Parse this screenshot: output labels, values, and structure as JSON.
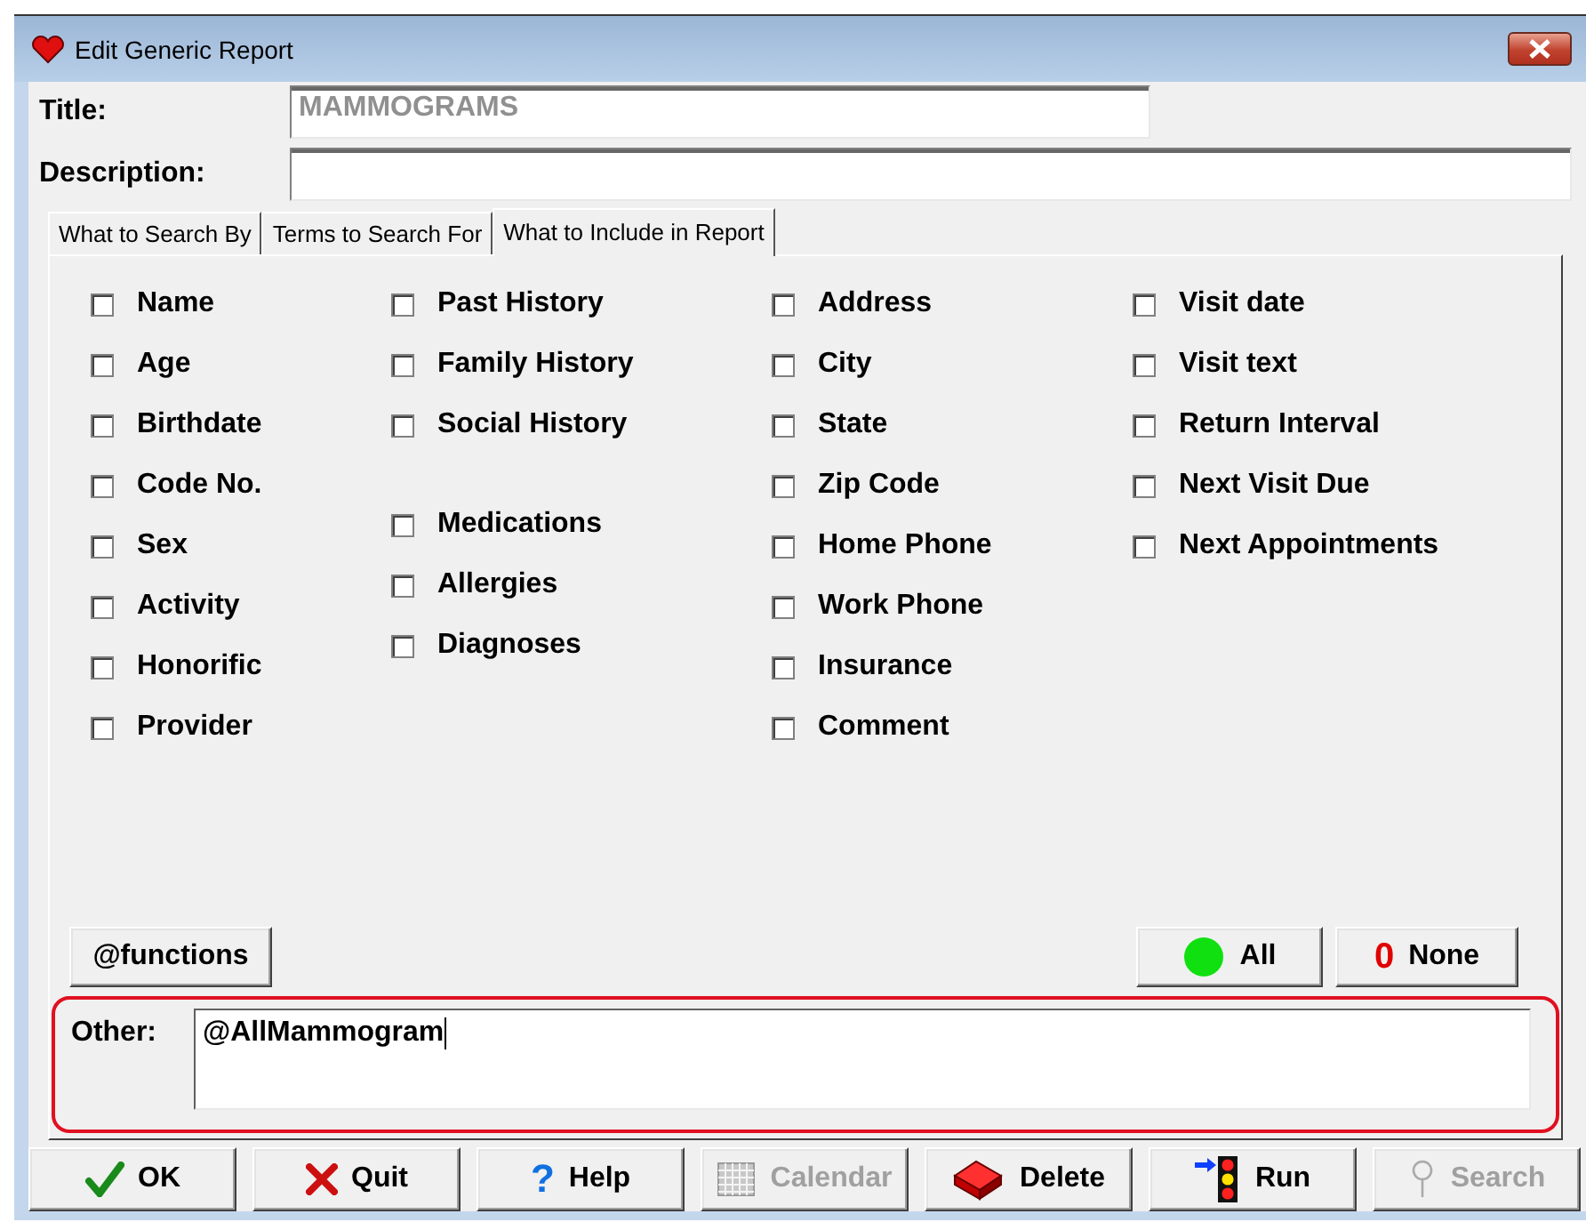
{
  "window": {
    "title": "Edit Generic Report"
  },
  "fields": [
    {
      "label": "Title:",
      "value": "MAMMOGRAMS",
      "disabled": true
    },
    {
      "label": "Description:"
    }
  ],
  "tabs": [
    {
      "label": "What to Search By",
      "selected": false
    },
    {
      "label": "Terms to Search For",
      "selected": false
    },
    {
      "label": "What to Include in Report",
      "selected": true
    }
  ],
  "columns": [
    {
      "groups": [
        [
          {
            "label": "Name",
            "checked": false
          },
          {
            "label": "Age",
            "checked": false
          },
          {
            "label": "Birthdate",
            "checked": false
          },
          {
            "label": "Code No.",
            "checked": false
          },
          {
            "label": "Sex",
            "checked": false
          },
          {
            "label": "Activity",
            "checked": false
          },
          {
            "label": "Honorific",
            "checked": false
          },
          {
            "label": "Provider",
            "checked": false
          }
        ]
      ]
    },
    {
      "groups": [
        [
          {
            "label": "Past History",
            "checked": false
          },
          {
            "label": "Family History",
            "checked": false
          },
          {
            "label": "Social History",
            "checked": false
          }
        ],
        [
          {
            "label": "Medications",
            "checked": false
          },
          {
            "label": "Allergies",
            "checked": false
          },
          {
            "label": "Diagnoses",
            "checked": false
          }
        ]
      ]
    },
    {
      "groups": [
        [
          {
            "label": "Address",
            "checked": false
          },
          {
            "label": "City",
            "checked": false
          },
          {
            "label": "State",
            "checked": false
          },
          {
            "label": "Zip Code",
            "checked": false
          },
          {
            "label": "Home Phone",
            "checked": false
          },
          {
            "label": "Work Phone",
            "checked": false
          },
          {
            "label": "Insurance",
            "checked": false
          },
          {
            "label": "Comment",
            "checked": false
          }
        ]
      ]
    },
    {
      "groups": [
        [
          {
            "label": "Visit date",
            "checked": false
          },
          {
            "label": "Visit text",
            "checked": false
          },
          {
            "label": "Return Interval",
            "checked": false
          },
          {
            "label": "Next Visit Due",
            "checked": false
          },
          {
            "label": "Next Appointments",
            "checked": false
          }
        ]
      ]
    }
  ],
  "panel_buttons": [
    {
      "kind": "functions",
      "label": "@functions"
    },
    {
      "kind": "all",
      "label": "All"
    },
    {
      "kind": "none",
      "label": "None",
      "glyph": "0"
    }
  ],
  "other": {
    "label": "Other:",
    "value": "@AllMammogram"
  },
  "buttons": [
    {
      "kind": "ok",
      "label": "OK",
      "disabled": false
    },
    {
      "kind": "quit",
      "label": "Quit",
      "disabled": false
    },
    {
      "kind": "help",
      "label": "Help",
      "glyph": "?",
      "disabled": false
    },
    {
      "kind": "calendar",
      "label": "Calendar",
      "disabled": true
    },
    {
      "kind": "delete",
      "label": "Delete",
      "disabled": false
    },
    {
      "kind": "run",
      "label": "Run",
      "disabled": false
    },
    {
      "kind": "search",
      "label": "Search",
      "disabled": true
    }
  ]
}
